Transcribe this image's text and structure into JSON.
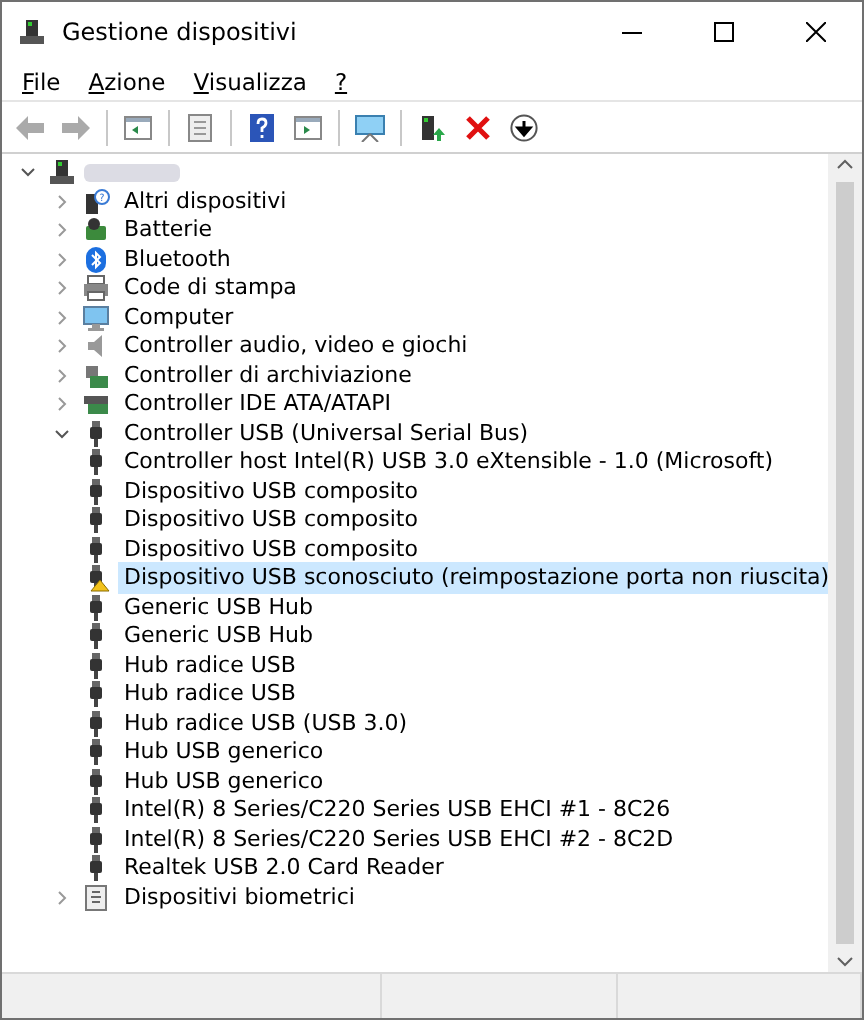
{
  "window": {
    "title": "Gestione dispositivi"
  },
  "menu": [
    {
      "label": "File"
    },
    {
      "label": "Azione"
    },
    {
      "label": "Visualizza"
    },
    {
      "label": "?"
    }
  ],
  "tree": {
    "expanded": true,
    "children": [
      {
        "label": "Altri dispositivi",
        "kind": "other",
        "expanded": false,
        "selected": false
      },
      {
        "label": "Batterie",
        "kind": "battery",
        "expanded": false,
        "selected": false
      },
      {
        "label": "Bluetooth",
        "kind": "bluetooth",
        "expanded": false,
        "selected": false
      },
      {
        "label": "Code di stampa",
        "kind": "printer",
        "expanded": false,
        "selected": false
      },
      {
        "label": "Computer",
        "kind": "monitor",
        "expanded": false,
        "selected": false
      },
      {
        "label": "Controller audio, video e giochi",
        "kind": "speaker",
        "expanded": false,
        "selected": false
      },
      {
        "label": "Controller di archiviazione",
        "kind": "storage",
        "expanded": false,
        "selected": false
      },
      {
        "label": "Controller IDE ATA/ATAPI",
        "kind": "ide",
        "expanded": false,
        "selected": false
      },
      {
        "label": "Controller USB (Universal Serial Bus)",
        "kind": "usb",
        "expanded": true,
        "selected": false,
        "children": [
          {
            "label": "Controller host Intel(R) USB 3.0 eXtensible - 1.0 (Microsoft)",
            "kind": "usb",
            "selected": false
          },
          {
            "label": "Dispositivo USB composito",
            "kind": "usb",
            "selected": false
          },
          {
            "label": "Dispositivo USB composito",
            "kind": "usb",
            "selected": false
          },
          {
            "label": "Dispositivo USB composito",
            "kind": "usb",
            "selected": false
          },
          {
            "label": "Dispositivo USB sconosciuto (reimpostazione porta non riuscita)",
            "kind": "usb-warning",
            "selected": true
          },
          {
            "label": "Generic USB Hub",
            "kind": "usb",
            "selected": false
          },
          {
            "label": "Generic USB Hub",
            "kind": "usb",
            "selected": false
          },
          {
            "label": "Hub radice USB",
            "kind": "usb",
            "selected": false
          },
          {
            "label": "Hub radice USB",
            "kind": "usb",
            "selected": false
          },
          {
            "label": "Hub radice USB (USB 3.0)",
            "kind": "usb",
            "selected": false
          },
          {
            "label": "Hub USB generico",
            "kind": "usb",
            "selected": false
          },
          {
            "label": "Hub USB generico",
            "kind": "usb",
            "selected": false
          },
          {
            "label": "Intel(R) 8 Series/C220 Series USB EHCI #1 - 8C26",
            "kind": "usb",
            "selected": false
          },
          {
            "label": "Intel(R) 8 Series/C220 Series USB EHCI #2 - 8C2D",
            "kind": "usb",
            "selected": false
          },
          {
            "label": "Realtek USB 2.0 Card Reader",
            "kind": "usb",
            "selected": false
          }
        ]
      },
      {
        "label": "Dispositivi biometrici",
        "kind": "biometric",
        "expanded": false,
        "selected": false
      }
    ]
  }
}
